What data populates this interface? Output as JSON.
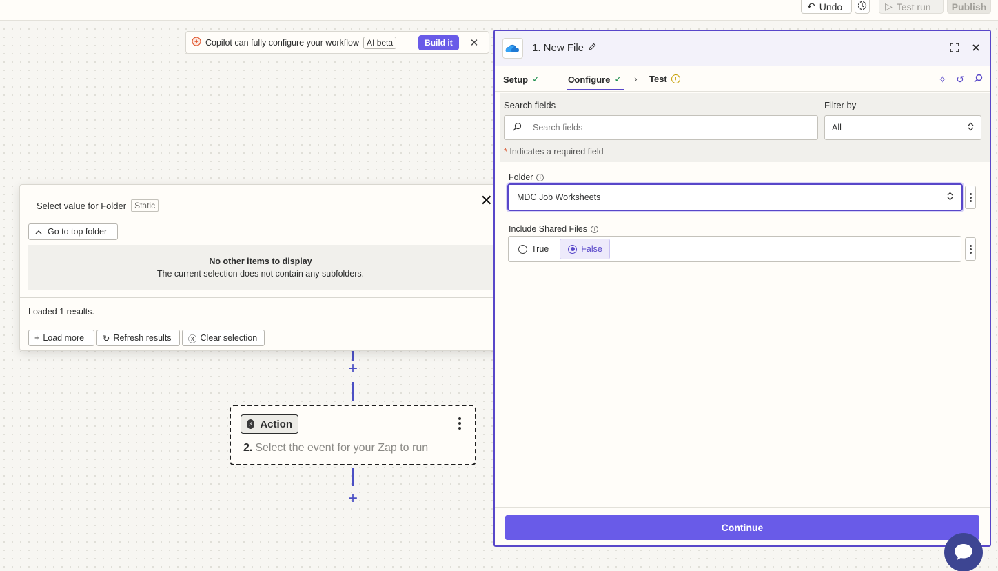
{
  "topbar": {
    "undo_label": "Undo",
    "test_run_label": "Test run",
    "publish_label": "Publish"
  },
  "copilot": {
    "text": "Copilot can fully configure your workflow",
    "badge": "AI beta",
    "build_label": "Build it",
    "close": "✕"
  },
  "flow": {
    "action_tag": "Action",
    "step_number": "2.",
    "step_text": "Select the event for your Zap to run",
    "plus": "+"
  },
  "popup": {
    "title": "Select value for Folder",
    "static_badge": "Static",
    "close": "✕",
    "go_top_label": "Go to top folder",
    "empty_title": "No other items to display",
    "empty_sub": "The current selection does not contain any subfolders.",
    "loaded_text": "Loaded 1 results.",
    "load_more": "Load more",
    "refresh": "Refresh results",
    "clear": "Clear selection"
  },
  "panel": {
    "title": "1. New File",
    "tabs": [
      {
        "label": "Setup"
      },
      {
        "label": "Configure"
      },
      {
        "label": "Test"
      }
    ],
    "search_label": "Search fields",
    "search_placeholder": "Search fields",
    "filter_label": "Filter by",
    "filter_value": "All",
    "required_note": "Indicates a required field",
    "required_star": "*",
    "folder_label": "Folder",
    "folder_value": "MDC Job Worksheets",
    "shared_label": "Include Shared Files",
    "shared_options": [
      "True",
      "False"
    ],
    "shared_selected": "False",
    "continue_label": "Continue"
  },
  "colors": {
    "accent": "#695be8",
    "panel_border": "#5847c9",
    "check": "#1d8f4e",
    "warning": "#c49d00"
  }
}
